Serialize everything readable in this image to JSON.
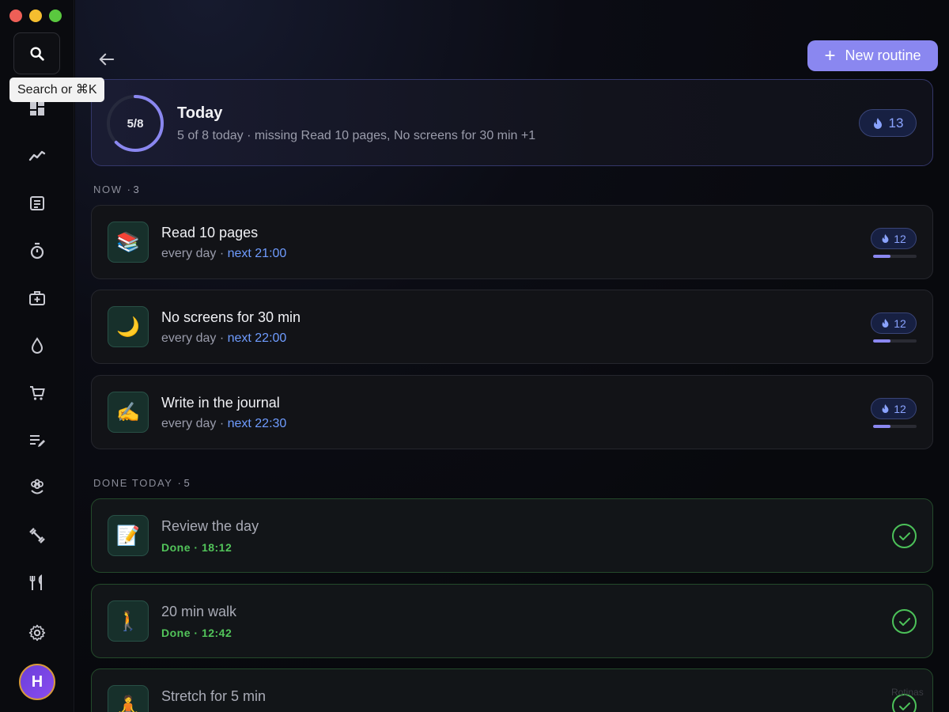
{
  "sidebar": {
    "tooltip": "Search or ⌘K",
    "avatar_initial": "H",
    "icons": [
      "search-icon",
      "dashboard-icon",
      "trend-icon",
      "notes-icon",
      "timer-icon",
      "medkit-icon",
      "water-drop-icon",
      "cart-icon",
      "edit-list-icon",
      "flower-icon",
      "dumbbell-icon",
      "utensils-icon",
      "gear-icon"
    ]
  },
  "header": {
    "new_routine_label": "New routine"
  },
  "today": {
    "ring_label": "5/8",
    "title": "Today",
    "subtitle": "5 of 8 today · missing Read 10 pages, No screens for 30 min +1",
    "streak": "13",
    "progress": 0.625
  },
  "sections": {
    "now_label": "NOW",
    "now_count": "· 3",
    "done_label": "DONE TODAY",
    "done_count": "· 5"
  },
  "now_items": [
    {
      "emoji": "📚",
      "title": "Read 10 pages",
      "freq": "every day · ",
      "next": "next 21:00",
      "streak": "12",
      "progress": 0.4
    },
    {
      "emoji": "🌙",
      "title": "No screens for 30 min",
      "freq": "every day · ",
      "next": "next 22:00",
      "streak": "12",
      "progress": 0.4
    },
    {
      "emoji": "✍️",
      "title": "Write in the journal",
      "freq": "every day · ",
      "next": "next 22:30",
      "streak": "12",
      "progress": 0.4
    }
  ],
  "done_items": [
    {
      "emoji": "📝",
      "title": "Review the day",
      "status": "Done · 18:12"
    },
    {
      "emoji": "🚶",
      "title": "20 min walk",
      "status": "Done · 12:42"
    },
    {
      "emoji": "🧘",
      "title": "Stretch for 5 min",
      "status": ""
    }
  ],
  "watermark": "Rotinas",
  "colors": {
    "accent": "#8a87f0",
    "streak_text": "#8aa3ff",
    "next_text": "#6f9cff",
    "done_green": "#52c45a"
  }
}
